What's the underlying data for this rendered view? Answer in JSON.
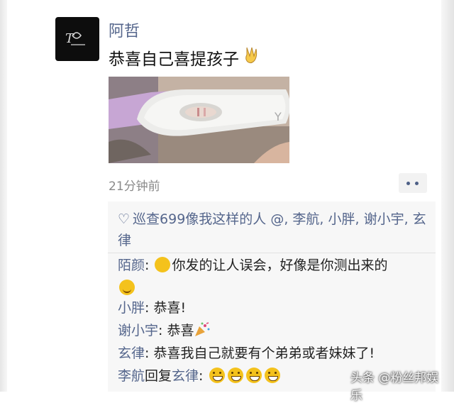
{
  "post": {
    "author": "阿哲",
    "text": "恭喜自己喜提孩子",
    "text_emoji_icon": "victory-hand-icon",
    "timestamp": "21分钟前"
  },
  "likes": {
    "icon": "heart-outline-icon",
    "text": "巡查699像我这样的人 @, 李航, 小胖, 谢小宇, 玄律"
  },
  "comments": [
    {
      "author": "陌颜",
      "separator": ":",
      "text": "你发的让人误会，好像是你测出来的",
      "emoji": [
        "facepalm-emoji",
        "thinking-emoji"
      ]
    },
    {
      "author": "小胖",
      "separator": ":",
      "text": "恭喜!"
    },
    {
      "author": "谢小宇",
      "separator": ":",
      "text": "恭喜",
      "emoji": [
        "party-popper-emoji"
      ]
    },
    {
      "author": "玄律",
      "separator": ":",
      "text": "恭喜我自己就要有个弟弟或者妹妹了!"
    },
    {
      "author": "李航",
      "reply_word": "回复",
      "reply_to": "玄律",
      "separator": ":",
      "emoji": [
        "grin-emoji",
        "grin-emoji",
        "grin-emoji",
        "grin-emoji"
      ]
    }
  ],
  "watermark": "头条 @粉丝邦娱乐",
  "colors": {
    "name_blue": "#55668c",
    "comment_bg": "#f7f7f7",
    "time_gray": "#8a8a8a"
  }
}
